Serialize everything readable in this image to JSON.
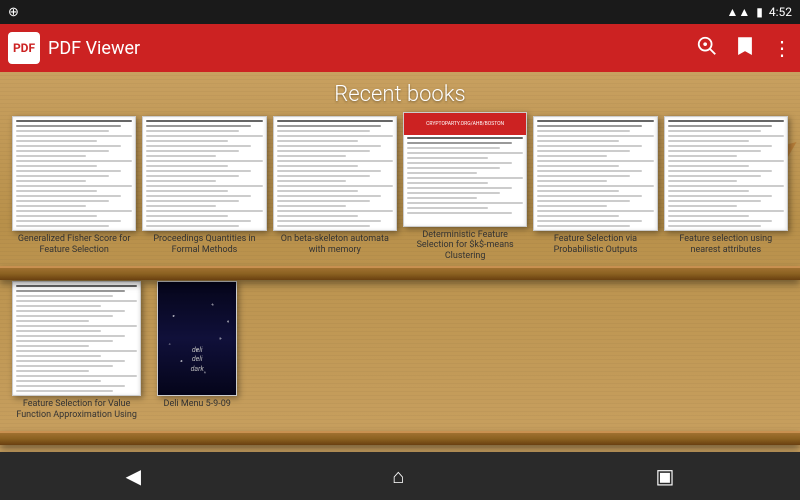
{
  "statusBar": {
    "time": "4:52",
    "icons": [
      "signal",
      "wifi",
      "battery"
    ]
  },
  "appBar": {
    "title": "PDF Viewer",
    "logoText": "PDF",
    "actions": [
      "search",
      "bookmark",
      "more"
    ]
  },
  "bookshelf": {
    "title": "Recent books",
    "row1": [
      {
        "id": "book1",
        "label": "Generalized Fisher Score for Feature Selection",
        "coverType": "plain"
      },
      {
        "id": "book2",
        "label": "Proceedings Quantities in Formal Methods",
        "coverType": "plain"
      },
      {
        "id": "book3",
        "label": "On beta-skeleton automata with memory",
        "coverType": "plain"
      },
      {
        "id": "book4",
        "label": "Deterministic Feature Selection for $k$-means Clustering",
        "coverType": "red-banner",
        "bannerText": "CRYPTOPARTY.ORG/AHB/BOSTON"
      },
      {
        "id": "book5",
        "label": "Feature Selection via Probabilistic Outputs",
        "coverType": "plain"
      },
      {
        "id": "book6",
        "label": "Feature selection using nearest attributes",
        "coverType": "plain"
      }
    ],
    "row2": [
      {
        "id": "book7",
        "label": "Feature Selection for Value Function Approximation Using",
        "coverType": "plain"
      },
      {
        "id": "book8",
        "label": "Deli Menu 5-9-09",
        "coverType": "dark",
        "darkTitle": "deli deli dark"
      }
    ]
  },
  "navBar": {
    "back": "◀",
    "home": "⌂",
    "recent": "▣"
  }
}
